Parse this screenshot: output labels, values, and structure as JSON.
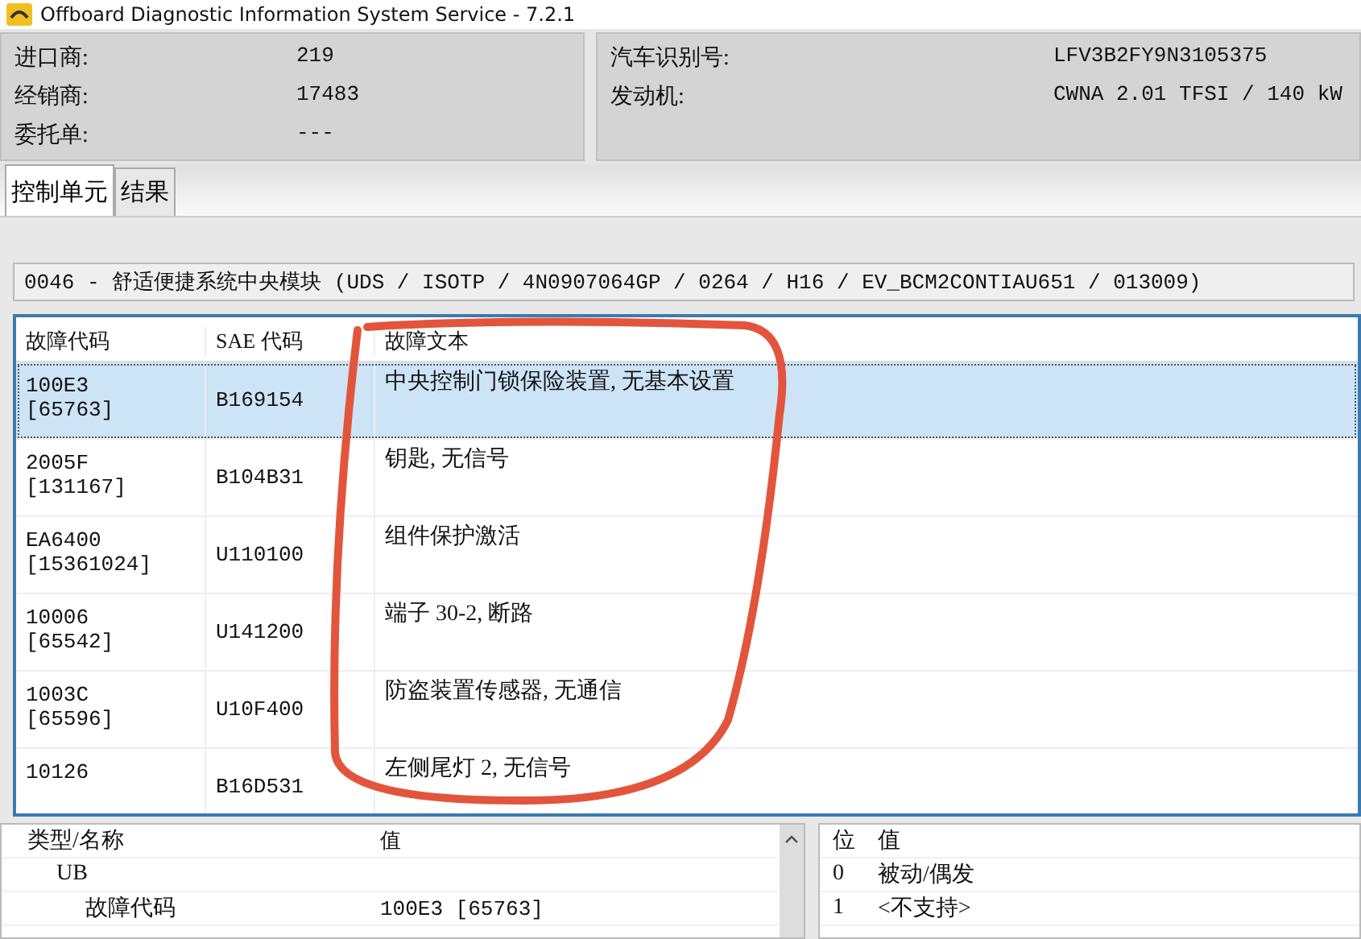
{
  "window": {
    "title": "Offboard Diagnostic Information System Service - 7.2.1"
  },
  "info_left": [
    {
      "label": "进口商:",
      "value": "219"
    },
    {
      "label": "经销商:",
      "value": "17483"
    },
    {
      "label": "委托单:",
      "value": "---"
    }
  ],
  "info_right": [
    {
      "label": "汽车识别号:",
      "value": "LFV3B2FY9N3105375"
    },
    {
      "label": "发动机:",
      "value": "CWNA 2.01 TFSI / 140 kW"
    }
  ],
  "tabs": [
    {
      "label": "控制单元",
      "selected": true
    },
    {
      "label": "结果",
      "selected": false
    }
  ],
  "module_line": "0046 - 舒适便捷系统中央模块  (UDS / ISOTP / 4N0907064GP / 0264 / H16 / EV_BCM2CONTIAU651 / 013009)",
  "fault_table": {
    "columns": [
      "故障代码",
      "SAE 代码",
      "故障文本"
    ],
    "rows": [
      {
        "code": "100E3",
        "code2": "[65763]",
        "sae": "B169154",
        "text": "中央控制门锁保险装置, 无基本设置",
        "selected": true
      },
      {
        "code": "2005F",
        "code2": "[131167]",
        "sae": "B104B31",
        "text": "钥匙, 无信号",
        "selected": false
      },
      {
        "code": "EA6400",
        "code2": "[15361024]",
        "sae": "U110100",
        "text": "组件保护激活",
        "selected": false
      },
      {
        "code": "10006",
        "code2": "[65542]",
        "sae": "U141200",
        "text": "端子 30-2, 断路",
        "selected": false
      },
      {
        "code": "1003C",
        "code2": "[65596]",
        "sae": "U10F400",
        "text": "防盗装置传感器, 无通信",
        "selected": false
      },
      {
        "code": "10126",
        "sae": "B16D531",
        "text": "左侧尾灯 2, 无信号",
        "selected": false
      }
    ]
  },
  "detail_table": {
    "columns": [
      "类型/名称",
      "值"
    ],
    "rows": [
      {
        "name": "UB",
        "children": [
          {
            "name": "故障代码",
            "value": "100E3 [65763]"
          }
        ]
      }
    ]
  },
  "bits_table": {
    "columns": [
      "位",
      "值"
    ],
    "rows": [
      {
        "bit": "0",
        "value": "被动/偶发"
      },
      {
        "bit": "1",
        "value": "<不支持>"
      }
    ]
  }
}
